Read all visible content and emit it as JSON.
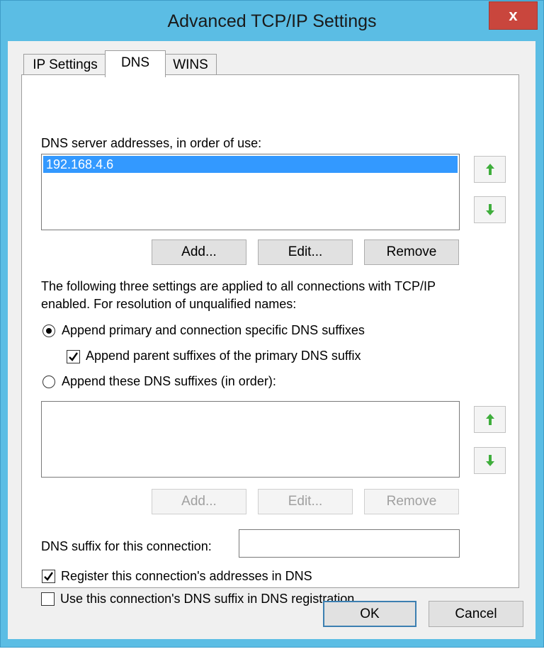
{
  "window": {
    "title": "Advanced TCP/IP Settings",
    "close_glyph": "x"
  },
  "tabs": [
    {
      "label": "IP Settings"
    },
    {
      "label": "DNS"
    },
    {
      "label": "WINS"
    }
  ],
  "dns_servers": {
    "label": "DNS server addresses, in order of use:",
    "items": [
      "192.168.4.6"
    ],
    "buttons": {
      "add": "Add...",
      "edit": "Edit...",
      "remove": "Remove"
    }
  },
  "info_text": {
    "line1": "The following three settings are applied to all connections with TCP/IP",
    "line2": "enabled. For resolution of unqualified names:"
  },
  "options": {
    "append_primary": {
      "label": "Append primary and connection specific DNS suffixes",
      "checked": true
    },
    "append_parent": {
      "label": "Append parent suffixes of the primary DNS suffix",
      "checked": true
    },
    "append_these": {
      "label": "Append these DNS suffixes (in order):",
      "checked": false
    }
  },
  "suffix_list": {
    "items": [],
    "buttons": {
      "add": "Add...",
      "edit": "Edit...",
      "remove": "Remove"
    }
  },
  "connection_suffix": {
    "label": "DNS suffix for this connection:",
    "value": ""
  },
  "registration": {
    "register": {
      "label": "Register this connection's addresses in DNS",
      "checked": true
    },
    "use_suffix": {
      "label": "Use this connection's DNS suffix in DNS registration",
      "checked": false
    }
  },
  "footer": {
    "ok": "OK",
    "cancel": "Cancel"
  },
  "colors": {
    "title_bar": "#5bbde4",
    "close": "#c9463d",
    "selection": "#3399ff",
    "arrow": "#3fae3c"
  },
  "icons": {
    "up": "arrow-up-icon",
    "down": "arrow-down-icon",
    "check": "checkmark-icon"
  }
}
